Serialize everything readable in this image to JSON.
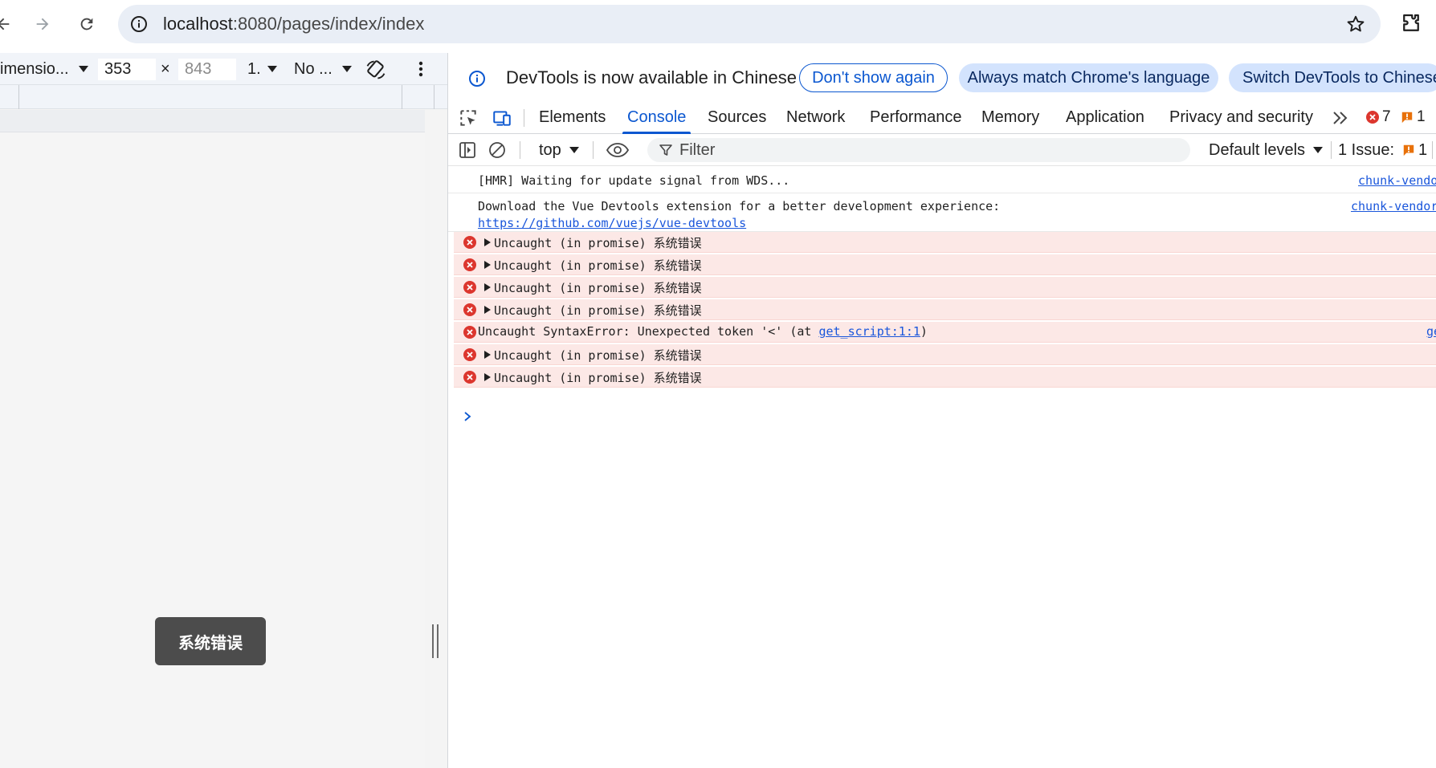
{
  "browser": {
    "url_host": "localhost",
    "url_rest": ":8080/pages/index/index",
    "icons": [
      "back-arrow-icon",
      "forward-arrow-icon",
      "reload-icon",
      "site-info-icon",
      "bookmark-star-icon",
      "extensions-icon"
    ]
  },
  "device_toolbar": {
    "dimensions_label": "imensio...",
    "width_value": "353",
    "times_sign": "×",
    "height_placeholder": "843",
    "zoom_label": "1.",
    "throttle_label": "No ...",
    "icons": [
      "rotate-icon",
      "more-vert-icon"
    ]
  },
  "page": {
    "toast_text": "系统错误"
  },
  "devtools": {
    "infobar": {
      "message": "DevTools is now available in Chinese",
      "dont_show": "Don't show again",
      "always_match": "Always match Chrome's language",
      "switch": "Switch DevTools to Chinese"
    },
    "tabs": [
      {
        "label": "Elements"
      },
      {
        "label": "Console"
      },
      {
        "label": "Sources"
      },
      {
        "label": "Network"
      },
      {
        "label": "Performance"
      },
      {
        "label": "Memory"
      },
      {
        "label": "Application"
      },
      {
        "label": "Privacy and security"
      }
    ],
    "active_tab": "Console",
    "error_count": "7",
    "warning_count": "1",
    "console_toolbar": {
      "context": "top",
      "filter_placeholder": "Filter",
      "levels": "Default levels",
      "issues_label": "1 Issue:",
      "issues_count": "1"
    },
    "logs": [
      {
        "text": "[HMR] Waiting for update signal from WDS...",
        "source": "chunk-vendo"
      },
      {
        "text": "Download the Vue Devtools extension for a better development experience:",
        "link": "https://github.com/vuejs/vue-devtools",
        "source": "chunk-vendor"
      }
    ],
    "errors": [
      {
        "text": "Uncaught (in promise) 系统错误"
      },
      {
        "text": "Uncaught (in promise) 系统错误"
      },
      {
        "text": "Uncaught (in promise) 系统错误"
      },
      {
        "text": "Uncaught (in promise) 系统错误"
      },
      {
        "prefix": "Uncaught SyntaxError: Unexpected token '<' (at ",
        "link": "get_script:1:1",
        "suffix": ")",
        "source": "ge"
      },
      {
        "text": "Uncaught (in promise) 系统错误"
      },
      {
        "text": "Uncaught (in promise) 系统错误"
      }
    ],
    "colors": {
      "accent": "#0b57d0",
      "error_bg": "#fce8e6",
      "error_icon": "#dc362e",
      "warning": "#e8710a"
    }
  }
}
